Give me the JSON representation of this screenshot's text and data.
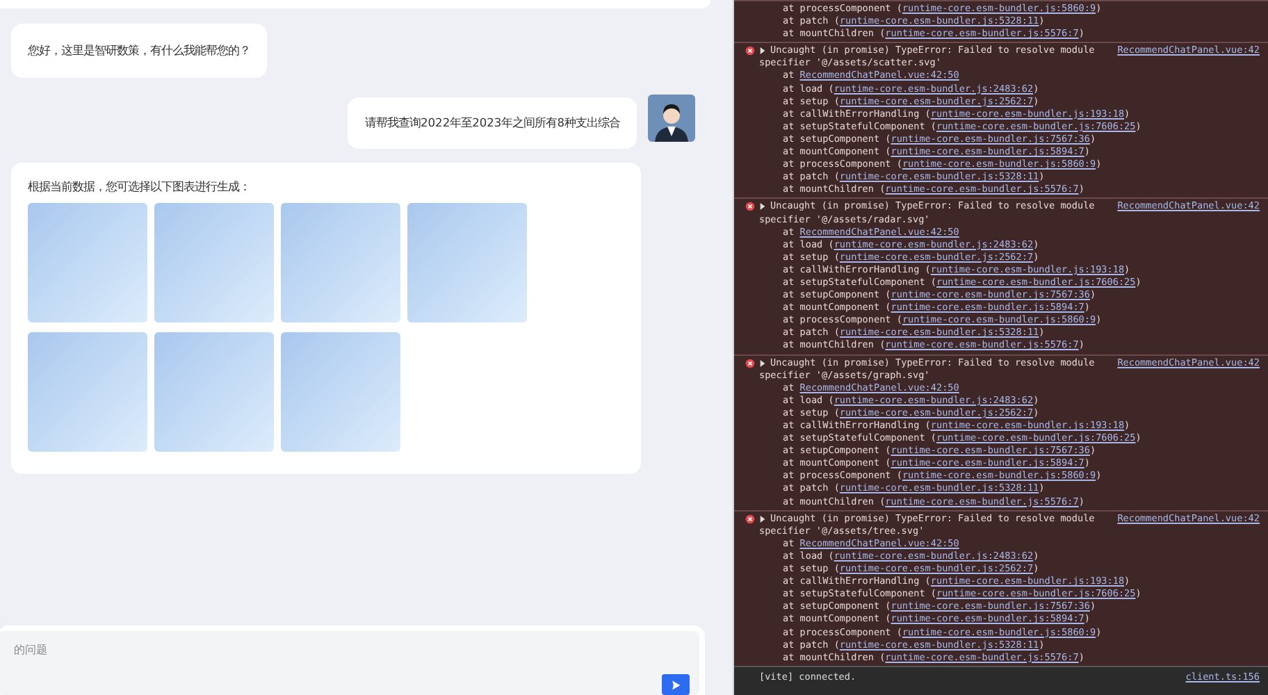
{
  "chat": {
    "messages": [
      {
        "kind": "bot",
        "text": "您好，这里是智研数策，有什么我能帮您的？"
      },
      {
        "kind": "user",
        "text": "请帮我查询2022年至2023年之间所有8种支出综合"
      },
      {
        "kind": "options",
        "text": "根据当前数据，您可选择以下图表进行生成：",
        "tiles": [
          {
            "kind": "tile"
          },
          {
            "kind": "tile"
          },
          {
            "kind": "tile"
          },
          {
            "kind": "tile"
          },
          {
            "kind": "tile"
          },
          {
            "kind": "tile"
          },
          {
            "kind": "tile"
          }
        ]
      }
    ],
    "input": {
      "placeholder": "的问题"
    }
  },
  "console": {
    "tail": [
      {
        "fn": "at processComponent (",
        "loc": "runtime-core.esm-bundler.js:5860:9",
        "end": ")"
      },
      {
        "fn": "at patch (",
        "loc": "runtime-core.esm-bundler.js:5328:11",
        "end": ")"
      },
      {
        "fn": "at mountChildren (",
        "loc": "runtime-core.esm-bundler.js:5576:7",
        "end": ")"
      }
    ],
    "errors": [
      {
        "message": "Uncaught (in promise) TypeError: Failed to resolve module",
        "source": "RecommendChatPanel.vue:42",
        "specifier": "specifier '@/assets/scatter.svg'",
        "expanded": false,
        "frames": [
          {
            "fn": "at ",
            "loc": "RecommendChatPanel.vue:42:50"
          },
          {
            "fn": "at load (",
            "loc": "runtime-core.esm-bundler.js:2483:62",
            "end": ")"
          },
          {
            "fn": "at setup (",
            "loc": "runtime-core.esm-bundler.js:2562:7",
            "end": ")"
          },
          {
            "fn": "at callWithErrorHandling (",
            "loc": "runtime-core.esm-bundler.js:193:18",
            "end": ")"
          },
          {
            "fn": "at setupStatefulComponent (",
            "loc": "runtime-core.esm-bundler.js:7606:25",
            "end": ")"
          },
          {
            "fn": "at setupComponent (",
            "loc": "runtime-core.esm-bundler.js:7567:36",
            "end": ")"
          },
          {
            "fn": "at mountComponent (",
            "loc": "runtime-core.esm-bundler.js:5894:7",
            "end": ")"
          },
          {
            "fn": "at processComponent (",
            "loc": "runtime-core.esm-bundler.js:5860:9",
            "end": ")"
          },
          {
            "fn": "at patch (",
            "loc": "runtime-core.esm-bundler.js:5328:11",
            "end": ")"
          },
          {
            "fn": "at mountChildren (",
            "loc": "runtime-core.esm-bundler.js:5576:7",
            "end": ")"
          }
        ]
      },
      {
        "message": "Uncaught (in promise) TypeError: Failed to resolve module",
        "source": "RecommendChatPanel.vue:42",
        "specifier": "specifier '@/assets/radar.svg'",
        "expanded": false,
        "frames": [
          {
            "fn": "at ",
            "loc": "RecommendChatPanel.vue:42:50"
          },
          {
            "fn": "at load (",
            "loc": "runtime-core.esm-bundler.js:2483:62",
            "end": ")"
          },
          {
            "fn": "at setup (",
            "loc": "runtime-core.esm-bundler.js:2562:7",
            "end": ")"
          },
          {
            "fn": "at callWithErrorHandling (",
            "loc": "runtime-core.esm-bundler.js:193:18",
            "end": ")"
          },
          {
            "fn": "at setupStatefulComponent (",
            "loc": "runtime-core.esm-bundler.js:7606:25",
            "end": ")"
          },
          {
            "fn": "at setupComponent (",
            "loc": "runtime-core.esm-bundler.js:7567:36",
            "end": ")"
          },
          {
            "fn": "at mountComponent (",
            "loc": "runtime-core.esm-bundler.js:5894:7",
            "end": ")"
          },
          {
            "fn": "at processComponent (",
            "loc": "runtime-core.esm-bundler.js:5860:9",
            "end": ")"
          },
          {
            "fn": "at patch (",
            "loc": "runtime-core.esm-bundler.js:5328:11",
            "end": ")"
          },
          {
            "fn": "at mountChildren (",
            "loc": "runtime-core.esm-bundler.js:5576:7",
            "end": ")"
          }
        ]
      },
      {
        "message": "Uncaught (in promise) TypeError: Failed to resolve module",
        "source": "RecommendChatPanel.vue:42",
        "specifier": "specifier '@/assets/graph.svg'",
        "expanded": false,
        "frames": [
          {
            "fn": "at ",
            "loc": "RecommendChatPanel.vue:42:50"
          },
          {
            "fn": "at load (",
            "loc": "runtime-core.esm-bundler.js:2483:62",
            "end": ")"
          },
          {
            "fn": "at setup (",
            "loc": "runtime-core.esm-bundler.js:2562:7",
            "end": ")"
          },
          {
            "fn": "at callWithErrorHandling (",
            "loc": "runtime-core.esm-bundler.js:193:18",
            "end": ")"
          },
          {
            "fn": "at setupStatefulComponent (",
            "loc": "runtime-core.esm-bundler.js:7606:25",
            "end": ")"
          },
          {
            "fn": "at setupComponent (",
            "loc": "runtime-core.esm-bundler.js:7567:36",
            "end": ")"
          },
          {
            "fn": "at mountComponent (",
            "loc": "runtime-core.esm-bundler.js:5894:7",
            "end": ")"
          },
          {
            "fn": "at processComponent (",
            "loc": "runtime-core.esm-bundler.js:5860:9",
            "end": ")"
          },
          {
            "fn": "at patch (",
            "loc": "runtime-core.esm-bundler.js:5328:11",
            "end": ")"
          },
          {
            "fn": "at mountChildren (",
            "loc": "runtime-core.esm-bundler.js:5576:7",
            "end": ")"
          }
        ]
      },
      {
        "message": "Uncaught (in promise) TypeError: Failed to resolve module",
        "source": "RecommendChatPanel.vue:42",
        "specifier": "specifier '@/assets/tree.svg'",
        "expanded": false,
        "frames": [
          {
            "fn": "at ",
            "loc": "RecommendChatPanel.vue:42:50"
          },
          {
            "fn": "at load (",
            "loc": "runtime-core.esm-bundler.js:2483:62",
            "end": ")"
          },
          {
            "fn": "at setup (",
            "loc": "runtime-core.esm-bundler.js:2562:7",
            "end": ")"
          },
          {
            "fn": "at callWithErrorHandling (",
            "loc": "runtime-core.esm-bundler.js:193:18",
            "end": ")"
          },
          {
            "fn": "at setupStatefulComponent (",
            "loc": "runtime-core.esm-bundler.js:7606:25",
            "end": ")"
          },
          {
            "fn": "at setupComponent (",
            "loc": "runtime-core.esm-bundler.js:7567:36",
            "end": ")"
          },
          {
            "fn": "at mountComponent (",
            "loc": "runtime-core.esm-bundler.js:5894:7",
            "end": ")"
          },
          {
            "fn": "at processComponent (",
            "loc": "runtime-core.esm-bundler.js:5860:9",
            "end": ")"
          },
          {
            "fn": "at patch (",
            "loc": "runtime-core.esm-bundler.js:5328:11",
            "end": ")"
          },
          {
            "fn": "at mountChildren (",
            "loc": "runtime-core.esm-bundler.js:5576:7",
            "end": ")"
          }
        ]
      }
    ],
    "status": {
      "text": "[vite] connected.",
      "source": "client.ts:156"
    }
  }
}
